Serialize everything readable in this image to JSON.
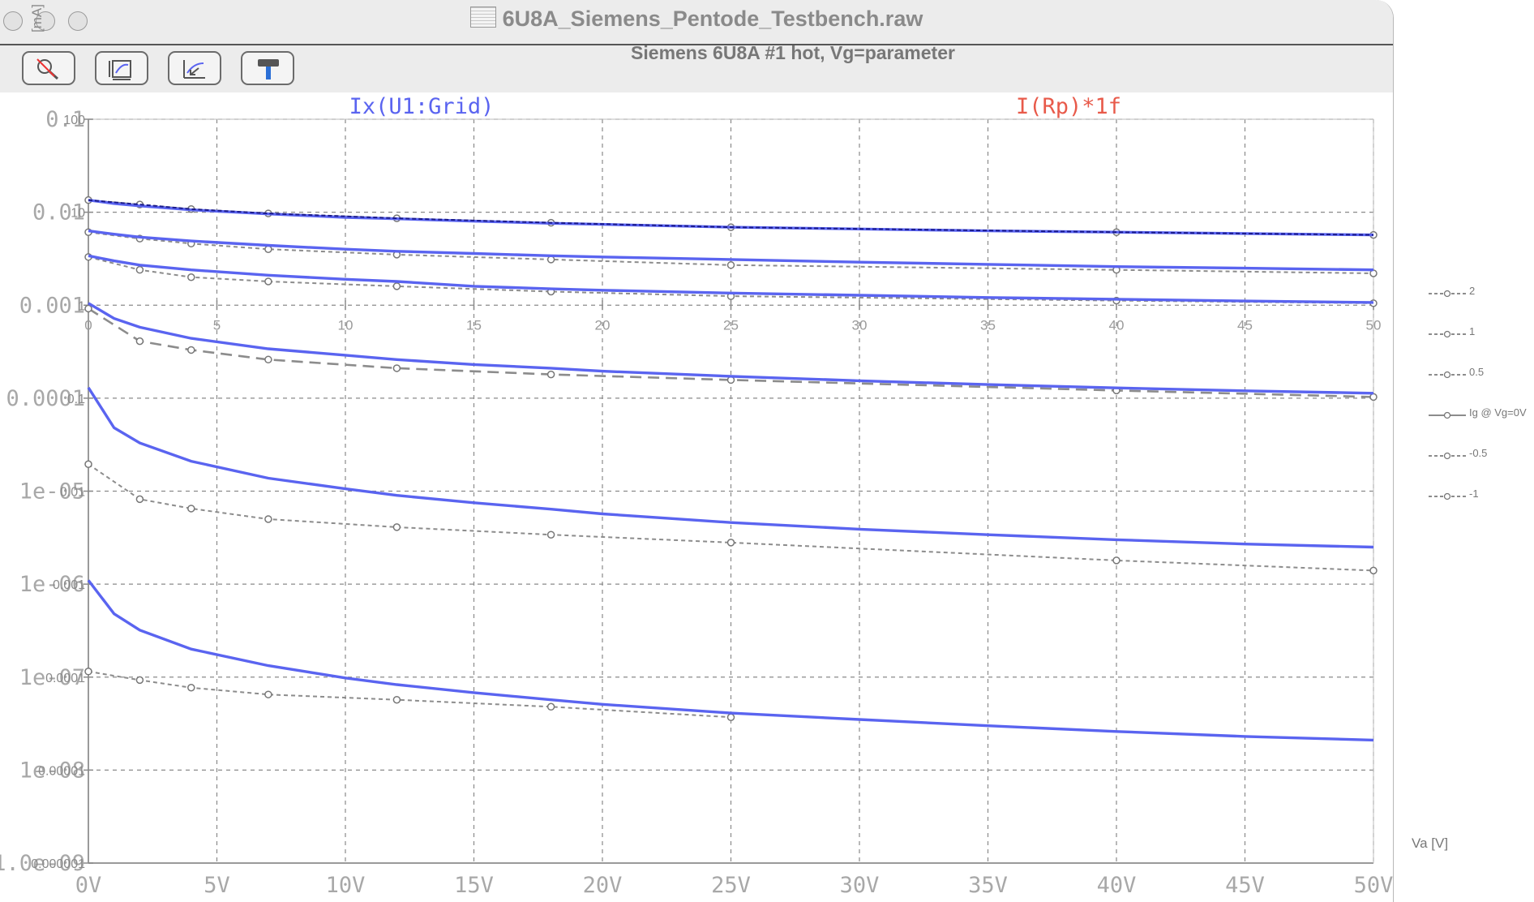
{
  "window": {
    "title": "6U8A_Siemens_Pentode_Testbench.raw",
    "toolbar": [
      {
        "icon": "zoom-cancel-icon",
        "tooltip": ""
      },
      {
        "icon": "autoscale-icon",
        "tooltip": ""
      },
      {
        "icon": "zoom-back-icon",
        "tooltip": ""
      },
      {
        "icon": "hammer-icon",
        "tooltip": ""
      }
    ]
  },
  "plot": {
    "title": "Siemens 6U8A #1 hot, Vg=parameter",
    "y_unit_label": "[mA]",
    "trace_blue": "Ix(U1:Grid)",
    "trace_red": "I(Rp)*1f",
    "x_axis_title": "Va [V]"
  },
  "legend": [
    {
      "label": "2",
      "style": "dashed"
    },
    {
      "label": "1",
      "style": "dashed"
    },
    {
      "label": "0.5",
      "style": "dashed"
    },
    {
      "label": "Ig @ Vg=0V",
      "style": "solid"
    },
    {
      "label": "-0.5",
      "style": "dashed"
    },
    {
      "label": "-1",
      "style": "dashed"
    }
  ],
  "colors": {
    "blue_trace": "#5a64f0",
    "dark_trace": "#1a1a8c",
    "red_label": "#e85a4a",
    "grid": "#8a8a8a",
    "measured": "#8c8c8c",
    "axis_text": "#9a9a9a"
  },
  "chart_data": {
    "type": "line",
    "x_ticks": [
      "0V",
      "5V",
      "10V",
      "15V",
      "20V",
      "25V",
      "30V",
      "35V",
      "40V",
      "45V",
      "50V"
    ],
    "inner_x_ticks": [
      "0",
      "5",
      "10",
      "15",
      "20",
      "25",
      "30",
      "35",
      "40",
      "45",
      "50"
    ],
    "y_ticks_left": [
      "0.1",
      "0.01",
      "0.001",
      "0.0001",
      "1e-05",
      "1e-06",
      "1e-07",
      "1e-08",
      "1.0e-09"
    ],
    "y_ticks_overlay": [
      "100",
      "10",
      "1",
      "0.1",
      "0.01",
      "0.001",
      "0.0001",
      "0.00001",
      "0.000001"
    ],
    "xlim": [
      0,
      50
    ],
    "y_decades_top": -1,
    "y_decades_bottom": -9,
    "series_model": [
      {
        "name": "2",
        "values": [
          [
            0,
            0.0135
          ],
          [
            1,
            0.0124
          ],
          [
            2,
            0.0117
          ],
          [
            4,
            0.0106
          ],
          [
            7,
            0.0096
          ],
          [
            10,
            0.0088
          ],
          [
            12,
            0.0085
          ],
          [
            15,
            0.008
          ],
          [
            18,
            0.0076
          ],
          [
            20,
            0.0074
          ],
          [
            25,
            0.0069
          ],
          [
            30,
            0.0066
          ],
          [
            35,
            0.0063
          ],
          [
            40,
            0.0061
          ],
          [
            45,
            0.0059
          ],
          [
            50,
            0.0057
          ]
        ]
      },
      {
        "name": "1",
        "values": [
          [
            0,
            0.0063
          ],
          [
            1,
            0.0058
          ],
          [
            2,
            0.0054
          ],
          [
            4,
            0.0049
          ],
          [
            7,
            0.0044
          ],
          [
            10,
            0.004
          ],
          [
            12,
            0.0038
          ],
          [
            15,
            0.0036
          ],
          [
            18,
            0.0034
          ],
          [
            20,
            0.0033
          ],
          [
            25,
            0.0031
          ],
          [
            30,
            0.0029
          ],
          [
            35,
            0.00275
          ],
          [
            40,
            0.0026
          ],
          [
            45,
            0.0025
          ],
          [
            50,
            0.0024
          ]
        ]
      },
      {
        "name": "0.5",
        "values": [
          [
            0,
            0.0034
          ],
          [
            1,
            0.003
          ],
          [
            2,
            0.0027
          ],
          [
            4,
            0.0024
          ],
          [
            7,
            0.0021
          ],
          [
            10,
            0.0019
          ],
          [
            12,
            0.0018
          ],
          [
            15,
            0.0016
          ],
          [
            18,
            0.0015
          ],
          [
            20,
            0.00145
          ],
          [
            25,
            0.00135
          ],
          [
            30,
            0.00128
          ],
          [
            35,
            0.00121
          ],
          [
            40,
            0.00116
          ],
          [
            45,
            0.00111
          ],
          [
            50,
            0.00107
          ]
        ]
      },
      {
        "name": "Ig @ Vg=0V",
        "values": [
          [
            0,
            0.00105
          ],
          [
            1,
            0.00072
          ],
          [
            2,
            0.00058
          ],
          [
            4,
            0.00044
          ],
          [
            7,
            0.00034
          ],
          [
            10,
            0.00029
          ],
          [
            12,
            0.00026
          ],
          [
            15,
            0.00023
          ],
          [
            18,
            0.00021
          ],
          [
            20,
            0.000195
          ],
          [
            25,
            0.000172
          ],
          [
            30,
            0.000154
          ],
          [
            35,
            0.00014
          ],
          [
            40,
            0.000129
          ],
          [
            45,
            0.00012
          ],
          [
            50,
            0.000113
          ]
        ]
      },
      {
        "name": "-0.5",
        "values": [
          [
            0,
            0.00013
          ],
          [
            1,
            4.8e-05
          ],
          [
            2,
            3.3e-05
          ],
          [
            4,
            2.1e-05
          ],
          [
            7,
            1.38e-05
          ],
          [
            10,
            1.06e-05
          ],
          [
            12,
            9e-06
          ],
          [
            15,
            7.5e-06
          ],
          [
            18,
            6.4e-06
          ],
          [
            20,
            5.7e-06
          ],
          [
            25,
            4.6e-06
          ],
          [
            30,
            3.9e-06
          ],
          [
            35,
            3.4e-06
          ],
          [
            40,
            3e-06
          ],
          [
            45,
            2.7e-06
          ],
          [
            50,
            2.5e-06
          ]
        ]
      },
      {
        "name": "-1",
        "values": [
          [
            0,
            1.1e-06
          ],
          [
            1,
            4.8e-07
          ],
          [
            2,
            3.2e-07
          ],
          [
            4,
            2e-07
          ],
          [
            7,
            1.33e-07
          ],
          [
            10,
            9.8e-08
          ],
          [
            12,
            8.3e-08
          ],
          [
            15,
            6.8e-08
          ],
          [
            18,
            5.7e-08
          ],
          [
            20,
            5.1e-08
          ],
          [
            25,
            4.1e-08
          ],
          [
            30,
            3.5e-08
          ],
          [
            35,
            3e-08
          ],
          [
            40,
            2.6e-08
          ],
          [
            45,
            2.3e-08
          ],
          [
            50,
            2.1e-08
          ]
        ]
      }
    ],
    "series_measured": [
      {
        "name": "2",
        "style": "dense-dash",
        "values": [
          [
            0,
            0.0135
          ],
          [
            2,
            0.0121
          ],
          [
            4,
            0.0108
          ],
          [
            7,
            0.0097
          ],
          [
            12,
            0.0086
          ],
          [
            18,
            0.0077
          ],
          [
            25,
            0.0069
          ],
          [
            40,
            0.0061
          ],
          [
            50,
            0.0057
          ]
        ]
      },
      {
        "name": "1",
        "style": "dense-dash",
        "values": [
          [
            0,
            0.0061
          ],
          [
            2,
            0.0052
          ],
          [
            4,
            0.0046
          ],
          [
            7,
            0.004
          ],
          [
            12,
            0.0035
          ],
          [
            18,
            0.0031
          ],
          [
            25,
            0.0027
          ],
          [
            40,
            0.0024
          ],
          [
            50,
            0.0022
          ]
        ]
      },
      {
        "name": "0.5",
        "style": "dense-dash",
        "values": [
          [
            0,
            0.0033
          ],
          [
            2,
            0.0024
          ],
          [
            4,
            0.002
          ],
          [
            7,
            0.0018
          ],
          [
            12,
            0.0016
          ],
          [
            18,
            0.0014
          ],
          [
            25,
            0.00125
          ],
          [
            40,
            0.00112
          ],
          [
            50,
            0.00105
          ]
        ]
      },
      {
        "name": "Ig @ Vg=0V",
        "style": "long-dash",
        "values": [
          [
            0,
            0.00092
          ],
          [
            2,
            0.00041
          ],
          [
            4,
            0.00033
          ],
          [
            7,
            0.00026
          ],
          [
            12,
            0.00021
          ],
          [
            18,
            0.00018
          ],
          [
            25,
            0.000157
          ],
          [
            40,
            0.000121
          ],
          [
            50,
            0.000103
          ]
        ]
      },
      {
        "name": "-0.5",
        "style": "dense-dash",
        "values": [
          [
            0,
            1.95e-05
          ],
          [
            2,
            8.2e-06
          ],
          [
            4,
            6.5e-06
          ],
          [
            7,
            5e-06
          ],
          [
            12,
            4.1e-06
          ],
          [
            18,
            3.4e-06
          ],
          [
            25,
            2.8e-06
          ],
          [
            40,
            1.8e-06
          ],
          [
            50,
            1.4e-06
          ]
        ]
      },
      {
        "name": "-1",
        "style": "dense-dash",
        "values": [
          [
            0,
            1.15e-07
          ],
          [
            2,
            9.3e-08
          ],
          [
            4,
            7.7e-08
          ],
          [
            7,
            6.5e-08
          ],
          [
            12,
            5.7e-08
          ],
          [
            18,
            4.8e-08
          ],
          [
            25,
            3.7e-08
          ]
        ]
      }
    ],
    "grid": true,
    "y_scale": "log",
    "legend_position": "right-outside"
  }
}
